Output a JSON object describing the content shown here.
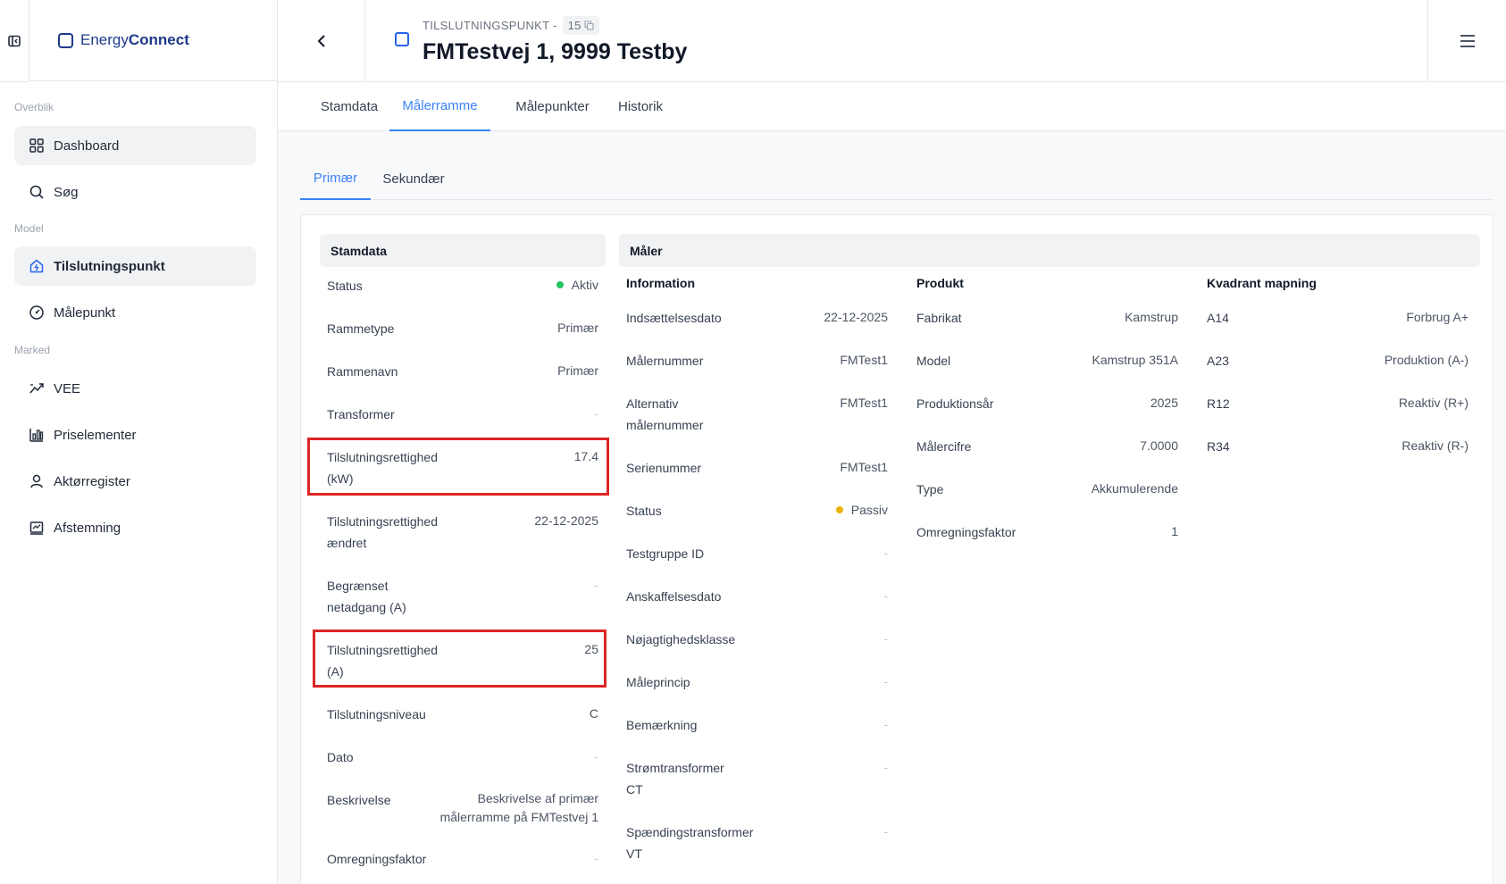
{
  "app": {
    "brand_plain": "Energy",
    "brand_bold": "Connect"
  },
  "sidebar": {
    "sections": [
      "Overblik",
      "Model",
      "Marked"
    ],
    "items": [
      {
        "label": "Dashboard",
        "icon": "grid-icon"
      },
      {
        "label": "Søg",
        "icon": "search-icon"
      },
      {
        "label": "Tilslutningspunkt",
        "icon": "home-plug-icon"
      },
      {
        "label": "Målepunkt",
        "icon": "gauge-icon"
      },
      {
        "label": "VEE",
        "icon": "trend-icon"
      },
      {
        "label": "Priselementer",
        "icon": "price-chart-icon"
      },
      {
        "label": "Aktørregister",
        "icon": "user-icon"
      },
      {
        "label": "Afstemning",
        "icon": "reconcile-icon"
      }
    ]
  },
  "header": {
    "kicker": "TILSLUTNINGSPUNKT -",
    "id": "15",
    "title": "FMTestvej 1, 9999 Testby"
  },
  "tabs": [
    "Stamdata",
    "Målerramme",
    "Målepunkter",
    "Historik"
  ],
  "subtabs": [
    "Primær",
    "Sekundær"
  ],
  "stamdata": {
    "heading": "Stamdata",
    "rows": [
      {
        "label": "Status",
        "value": "Aktiv"
      },
      {
        "label": "Rammetype",
        "value": "Primær"
      },
      {
        "label": "Rammenavn",
        "value": "Primær"
      },
      {
        "label": "Transformer",
        "value": "-"
      },
      {
        "label": "Tilslutningsrettighed (kW)",
        "value": "17.4"
      },
      {
        "label": "Tilslutningsrettighed ændret",
        "value": "22-12-2025"
      },
      {
        "label": "Begrænset netadgang (A)",
        "value": "-"
      },
      {
        "label": "Tilslutningsrettighed (A)",
        "value": "25"
      },
      {
        "label": "Tilslutningsniveau",
        "value": "C"
      },
      {
        "label": "Dato",
        "value": "-"
      },
      {
        "label": "Beskrivelse",
        "value": "Beskrivelse af primær målerramme på FMTestvej 1"
      },
      {
        "label": "Omregningsfaktor",
        "value": "-"
      }
    ]
  },
  "maaler": {
    "heading": "Måler",
    "information": {
      "heading": "Information",
      "rows": [
        {
          "label": "Indsættelsesdato",
          "value": "22-12-2025"
        },
        {
          "label": "Målernummer",
          "value": "FMTest1"
        },
        {
          "label": "Alternativ målernummer",
          "value": "FMTest1"
        },
        {
          "label": "Serienummer",
          "value": "FMTest1"
        },
        {
          "label": "Status",
          "value": "Passiv"
        },
        {
          "label": "Testgruppe ID",
          "value": "-"
        },
        {
          "label": "Anskaffelsesdato",
          "value": "-"
        },
        {
          "label": "Nøjagtighedsklasse",
          "value": "-"
        },
        {
          "label": "Måleprincip",
          "value": "-"
        },
        {
          "label": "Bemærkning",
          "value": "-"
        },
        {
          "label": "Strømtransformer CT",
          "value": "-"
        },
        {
          "label": "Spændingstransformer VT",
          "value": "-"
        }
      ]
    },
    "produkt": {
      "heading": "Produkt",
      "rows": [
        {
          "label": "Fabrikat",
          "value": "Kamstrup"
        },
        {
          "label": "Model",
          "value": "Kamstrup 351A"
        },
        {
          "label": "Produktionsår",
          "value": "2025"
        },
        {
          "label": "Målercifre",
          "value": "7.0000"
        },
        {
          "label": "Type",
          "value": "Akkumulerende"
        },
        {
          "label": "Omregningsfaktor",
          "value": "1"
        }
      ]
    },
    "kvadrant": {
      "heading": "Kvadrant mapning",
      "rows": [
        {
          "label": "A14",
          "value": "Forbrug A+"
        },
        {
          "label": "A23",
          "value": "Produktion (A-)"
        },
        {
          "label": "R12",
          "value": "Reaktiv (R+)"
        },
        {
          "label": "R34",
          "value": "Reaktiv (R-)"
        }
      ]
    }
  },
  "colors": {
    "accent": "#3b82f6",
    "active": "#22c55e",
    "passive": "#eab308",
    "highlight": "#dc2626"
  }
}
